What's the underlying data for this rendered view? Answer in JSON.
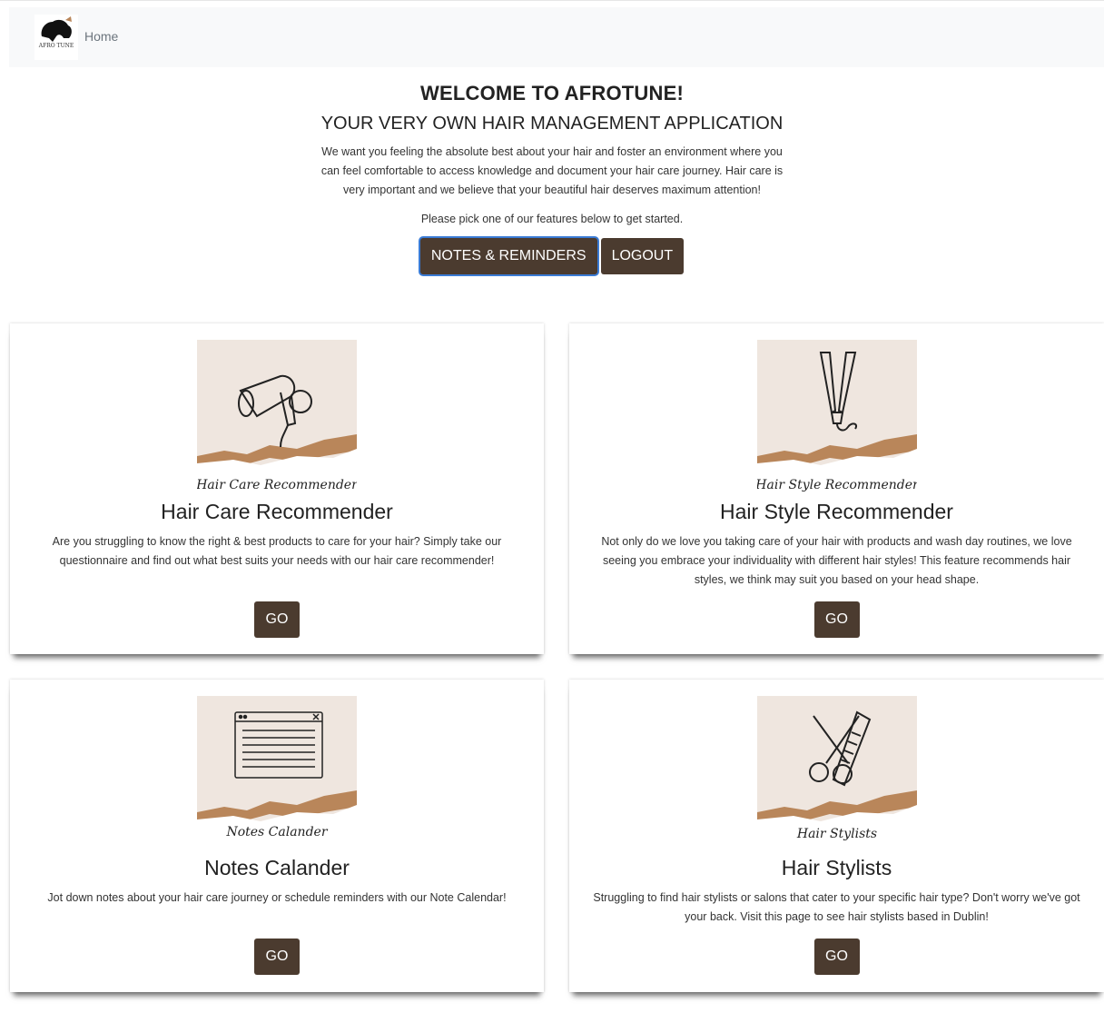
{
  "nav": {
    "logo_text": "AFRO TUNE",
    "home_label": "Home"
  },
  "hero": {
    "title": "WELCOME TO AFROTUNE!",
    "subtitle": "YOUR VERY OWN HAIR MANAGEMENT APPLICATION",
    "intro": "We want you feeling the absolute best about your hair and foster an environment where you can feel comfortable to access knowledge and document your hair care journey. Hair care is very important and we believe that your beautiful hair deserves maximum attention!",
    "pick": "Please pick one of our features below to get started.",
    "notes_button": "NOTES & REMINDERS",
    "logout_button": "LOGOUT"
  },
  "cards": [
    {
      "image_caption": "Hair Care Recommender",
      "icon": "hair-dryer-icon",
      "title": "Hair Care Recommender",
      "text": "Are you struggling to know the right & best products to care for your hair? Simply take our questionnaire and find out what best suits your needs with our hair care recommender!",
      "button": "GO"
    },
    {
      "image_caption": "Hair Style Recommender",
      "icon": "flat-iron-icon",
      "title": "Hair Style Recommender",
      "text": "Not only do we love you taking care of your hair with products and wash day routines, we love seeing you embrace your individuality with different hair styles! This feature recommends hair styles, we think may suit you based on your head shape.",
      "button": "GO"
    },
    {
      "image_caption": "Notes Calander",
      "icon": "notepad-window-icon",
      "title": "Notes Calander",
      "text": "Jot down notes about your hair care journey or schedule reminders with our Note Calendar!",
      "button": "GO"
    },
    {
      "image_caption": "Hair Stylists",
      "icon": "scissors-comb-icon",
      "title": "Hair Stylists",
      "text": "Struggling to find hair stylists or salons that cater to your specific hair type? Don't worry we've got your back. Visit this page to see hair stylists based in Dublin!",
      "button": "GO"
    }
  ],
  "colors": {
    "button_bg": "#4b3b2f",
    "navbar_bg": "#f8f9fa",
    "image_bg": "#efe6df",
    "tear_brown": "#b9865a"
  }
}
